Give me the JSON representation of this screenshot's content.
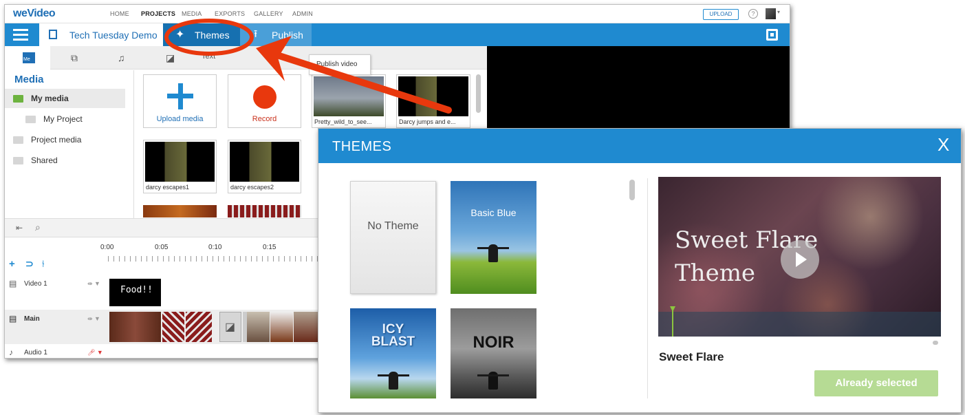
{
  "editor": {
    "logo": "weVideo",
    "nav": [
      "HOME",
      "PROJECTS",
      "MEDIA",
      "EXPORTS",
      "GALLERY",
      "ADMIN"
    ],
    "upload_label": "UPLOAD",
    "help_glyph": "?",
    "project_title": "Tech Tuesday Demo",
    "themes_label": "Themes",
    "publish_label": "Publish",
    "tooltip": "Publish video",
    "tab_media_icon_text": "Me",
    "tab_text_label": "Text",
    "sidebar": {
      "heading": "Media",
      "items": [
        "My media",
        "My Project",
        "Project media",
        "Shared"
      ]
    },
    "media_tiles": {
      "upload_label": "Upload media",
      "record_label": "Record",
      "clips": [
        "Pretty_wild_to_see...",
        "Darcy jumps and e...",
        "darcy escapes1",
        "darcy escapes2"
      ]
    },
    "ruler": [
      "0:00",
      "0:05",
      "0:10",
      "0:15"
    ],
    "tracks": {
      "video1": "Video 1",
      "main": "Main",
      "audio1": "Audio 1",
      "food_clip_text": "Food!!"
    }
  },
  "dialog": {
    "title": "THEMES",
    "close_glyph": "X",
    "themes": {
      "none": "No Theme",
      "basic_blue": "Basic Blue",
      "icy_line1": "ICY",
      "icy_line2": "BLAST",
      "noir": "NOIR"
    },
    "preview_title_line1": "Sweet Flare",
    "preview_title_line2": "Theme",
    "selected_theme_name": "Sweet Flare",
    "action_label": "Already selected"
  },
  "colors": {
    "brand_blue": "#1f8ad0",
    "annotation_red": "#e8380d",
    "selected_green": "#b6db94"
  }
}
